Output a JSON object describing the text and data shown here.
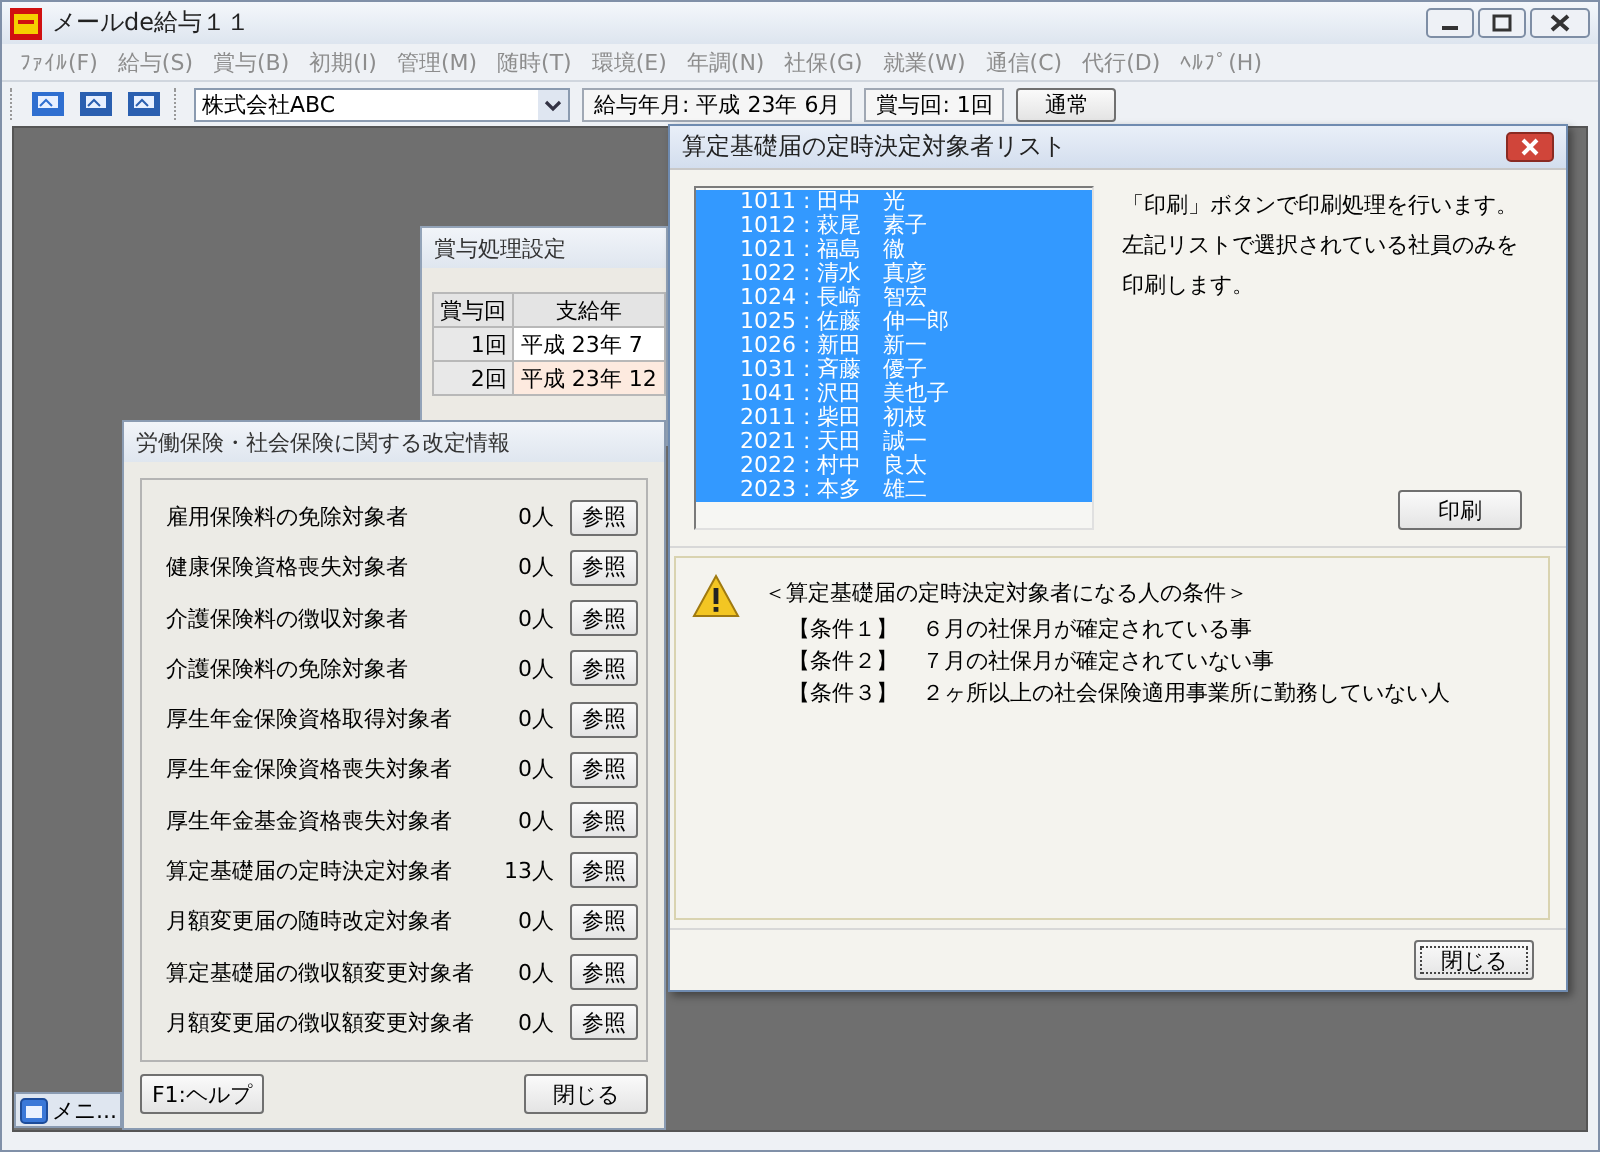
{
  "window": {
    "title": "メールde給与１１"
  },
  "menu": [
    {
      "label": "ﾌｧｲﾙ(F)",
      "disabled": true
    },
    {
      "label": "給与(S)",
      "disabled": true
    },
    {
      "label": "賞与(B)",
      "disabled": true
    },
    {
      "label": "初期(I)",
      "disabled": true
    },
    {
      "label": "管理(M)",
      "disabled": true
    },
    {
      "label": "随時(T)",
      "disabled": true
    },
    {
      "label": "環境(E)",
      "disabled": true
    },
    {
      "label": "年調(N)",
      "disabled": true
    },
    {
      "label": "社保(G)",
      "disabled": true
    },
    {
      "label": "就業(W)",
      "disabled": true
    },
    {
      "label": "通信(C)",
      "disabled": true
    },
    {
      "label": "代行(D)",
      "disabled": true
    },
    {
      "label": "ﾍﾙﾌﾟ(H)",
      "disabled": true
    }
  ],
  "toolbar": {
    "company": "株式会社ABC",
    "pay_month": "給与年月: 平成 23年  6月",
    "bonus_round": "賞与回: 1回",
    "mode_button": "通常"
  },
  "bonus_window": {
    "title": "賞与処理設定",
    "columns": [
      "賞与回",
      "支給年"
    ],
    "rows": [
      {
        "cells": [
          "1回",
          "平成 23年 7"
        ],
        "selected": false
      },
      {
        "cells": [
          "2回",
          "平成 23年 12"
        ],
        "selected": true
      }
    ]
  },
  "revision_dialog": {
    "title": "労働保険・社会保険に関する改定情報",
    "items": [
      {
        "label": "雇用保険料の免除対象者",
        "count": "0人",
        "button": "参照"
      },
      {
        "label": "健康保険資格喪失対象者",
        "count": "0人",
        "button": "参照"
      },
      {
        "label": "介護保険料の徴収対象者",
        "count": "0人",
        "button": "参照"
      },
      {
        "label": "介護保険料の免除対象者",
        "count": "0人",
        "button": "参照"
      },
      {
        "label": "厚生年金保険資格取得対象者",
        "count": "0人",
        "button": "参照"
      },
      {
        "label": "厚生年金保険資格喪失対象者",
        "count": "0人",
        "button": "参照"
      },
      {
        "label": "厚生年金基金資格喪失対象者",
        "count": "0人",
        "button": "参照"
      },
      {
        "label": "算定基礎届の定時決定対象者",
        "count": "13人",
        "button": "参照"
      },
      {
        "label": "月額変更届の随時改定対象者",
        "count": "0人",
        "button": "参照"
      },
      {
        "label": "算定基礎届の徴収額変更対象者",
        "count": "0人",
        "button": "参照"
      },
      {
        "label": "月額変更届の徴収額変更対象者",
        "count": "0人",
        "button": "参照"
      }
    ],
    "help_button": "F1:ヘルプ",
    "close_button": "閉じる"
  },
  "target_dialog": {
    "title": "算定基礎届の定時決定対象者リスト",
    "employees": [
      {
        "text": "1011 : 田中　光",
        "selected": true
      },
      {
        "text": "1012 : 萩尾　素子",
        "selected": true
      },
      {
        "text": "1021 : 福島　徹",
        "selected": true
      },
      {
        "text": "1022 : 清水　真彦",
        "selected": true
      },
      {
        "text": "1024 : 長崎　智宏",
        "selected": true
      },
      {
        "text": "1025 : 佐藤　伸一郎",
        "selected": true
      },
      {
        "text": "1026 : 新田　新一",
        "selected": true
      },
      {
        "text": "1031 : 斉藤　優子",
        "selected": true
      },
      {
        "text": "1041 : 沢田　美也子",
        "selected": true
      },
      {
        "text": "2011 : 柴田　初枝",
        "selected": true
      },
      {
        "text": "2021 : 天田　誠一",
        "selected": true
      },
      {
        "text": "2022 : 村中　良太",
        "selected": true
      },
      {
        "text": "2023 : 本多　雄二",
        "selected": true
      }
    ],
    "description": [
      "「印刷」ボタンで印刷処理を行います。",
      "左記リストで選択されている社員のみを",
      "印刷します。"
    ],
    "print_button": "印刷",
    "conditions_heading": "＜算定基礎届の定時決定対象者になる人の条件＞",
    "conditions": [
      {
        "label": "【条件１】",
        "text": "６月の社保月が確定されている事"
      },
      {
        "label": "【条件２】",
        "text": "７月の社保月が確定されていない事"
      },
      {
        "label": "【条件３】",
        "text": "２ヶ所以上の社会保険適用事業所に勤務していない人"
      }
    ],
    "close_button": "閉じる"
  },
  "minimized_window": {
    "title": "メニ..."
  }
}
